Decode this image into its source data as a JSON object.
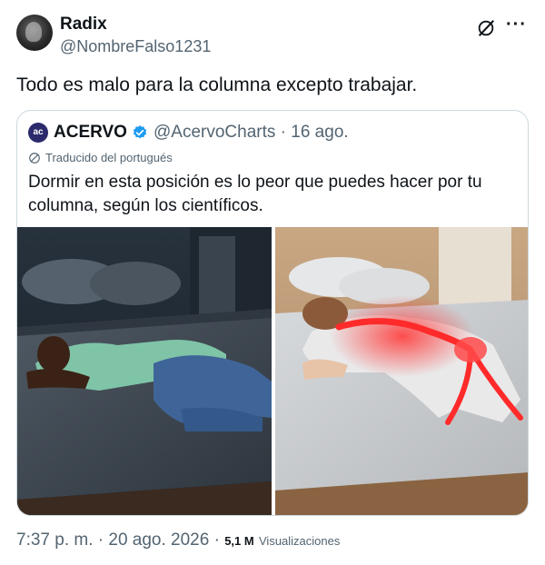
{
  "author": {
    "name": "Radix",
    "handle": "@NombreFalso1231"
  },
  "tweet": {
    "text": "Todo es malo para la columna excepto trabajar."
  },
  "quoted": {
    "name": "ACERVO",
    "handle_date": "@AcervoCharts · 16 ago.",
    "translated_label": "Traducido del portugués",
    "text": "Dormir en esta posición es lo peor que puedes hacer por tu columna, según los científicos.",
    "verified_color": "#1d9bf0"
  },
  "meta": {
    "time_date": "7:37 p. m. · 20 ago. 2026 ·",
    "views_count": "5,1 M",
    "views_label": "Visualizaciones"
  },
  "icons": {
    "grok": "grok-icon",
    "more": "more-icon",
    "verified": "verified-badge-icon",
    "translate": "globe-icon"
  }
}
